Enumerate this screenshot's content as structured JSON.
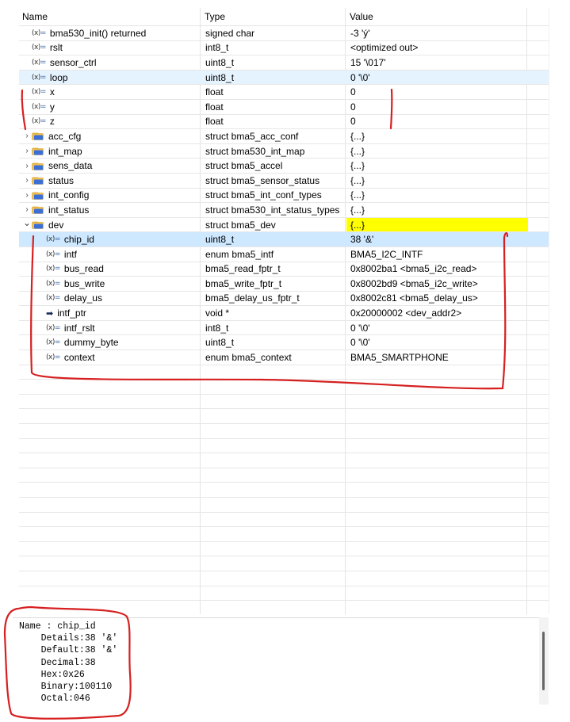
{
  "headers": {
    "name": "Name",
    "type": "Type",
    "value": "Value"
  },
  "rows": [
    {
      "name": "bma530_init() returned",
      "type": "signed char",
      "value": "-3 'ý'",
      "icon": "variable-icon",
      "indent": 0
    },
    {
      "name": "rslt",
      "type": "int8_t",
      "value": "<optimized out>",
      "icon": "variable-icon",
      "indent": 0
    },
    {
      "name": "sensor_ctrl",
      "type": "uint8_t",
      "value": "15 '\\017'",
      "icon": "variable-icon",
      "indent": 0
    },
    {
      "name": "loop",
      "type": "uint8_t",
      "value": "0 '\\0'",
      "icon": "variable-icon",
      "indent": 0,
      "state": "highlight"
    },
    {
      "name": "x",
      "type": "float",
      "value": "0",
      "icon": "variable-icon",
      "indent": 0
    },
    {
      "name": "y",
      "type": "float",
      "value": "0",
      "icon": "variable-icon",
      "indent": 0
    },
    {
      "name": "z",
      "type": "float",
      "value": "0",
      "icon": "variable-icon",
      "indent": 0
    },
    {
      "name": "acc_cfg",
      "type": "struct bma5_acc_conf",
      "value": "{...}",
      "icon": "struct-icon",
      "indent": 0,
      "twisty": "collapsed"
    },
    {
      "name": "int_map",
      "type": "struct bma530_int_map",
      "value": "{...}",
      "icon": "struct-icon",
      "indent": 0,
      "twisty": "collapsed"
    },
    {
      "name": "sens_data",
      "type": "struct bma5_accel",
      "value": "{...}",
      "icon": "struct-icon",
      "indent": 0,
      "twisty": "collapsed"
    },
    {
      "name": "status",
      "type": "struct bma5_sensor_status",
      "value": "{...}",
      "icon": "struct-icon",
      "indent": 0,
      "twisty": "collapsed"
    },
    {
      "name": "int_config",
      "type": "struct bma5_int_conf_types",
      "value": "{...}",
      "icon": "struct-icon",
      "indent": 0,
      "twisty": "collapsed"
    },
    {
      "name": "int_status",
      "type": "struct bma530_int_status_types",
      "value": "{...}",
      "icon": "struct-icon",
      "indent": 0,
      "twisty": "collapsed"
    },
    {
      "name": "dev",
      "type": "struct bma5_dev",
      "value": "{...}",
      "icon": "struct-icon",
      "indent": 0,
      "twisty": "expanded",
      "value_highlight": true
    },
    {
      "name": "chip_id",
      "type": "uint8_t",
      "value": "38 '&'",
      "icon": "variable-icon",
      "indent": 1,
      "state": "selected"
    },
    {
      "name": "intf",
      "type": "enum bma5_intf",
      "value": "BMA5_I2C_INTF",
      "icon": "variable-icon",
      "indent": 1
    },
    {
      "name": "bus_read",
      "type": "bma5_read_fptr_t",
      "value": "0x8002ba1 <bma5_i2c_read>",
      "icon": "variable-icon",
      "indent": 1
    },
    {
      "name": "bus_write",
      "type": "bma5_write_fptr_t",
      "value": "0x8002bd9 <bma5_i2c_write>",
      "icon": "variable-icon",
      "indent": 1
    },
    {
      "name": "delay_us",
      "type": "bma5_delay_us_fptr_t",
      "value": "0x8002c81 <bma5_delay_us>",
      "icon": "variable-icon",
      "indent": 1
    },
    {
      "name": "intf_ptr",
      "type": "void *",
      "value": "0x20000002 <dev_addr2>",
      "icon": "pointer-arrow-icon",
      "indent": 1
    },
    {
      "name": "intf_rslt",
      "type": "int8_t",
      "value": "0 '\\0'",
      "icon": "variable-icon",
      "indent": 1
    },
    {
      "name": "dummy_byte",
      "type": "uint8_t",
      "value": "0 '\\0'",
      "icon": "variable-icon",
      "indent": 1
    },
    {
      "name": "context",
      "type": "enum bma5_context",
      "value": "BMA5_SMARTPHONE",
      "icon": "variable-icon",
      "indent": 1
    }
  ],
  "empty_rows": 16,
  "details": {
    "lines": [
      "Name : chip_id",
      "    Details:38 '&'",
      "    Default:38 '&'",
      "    Decimal:38",
      "    Hex:0x26",
      "    Binary:100110",
      "    Octal:046"
    ]
  },
  "colors": {
    "selected_row": "#cde8ff",
    "highlight_row": "#e5f3ff",
    "value_highlight": "#ffff00",
    "annotation": "#d62020",
    "folder_yellow": "#f2c14e",
    "folder_blue": "#3b6fd8"
  }
}
